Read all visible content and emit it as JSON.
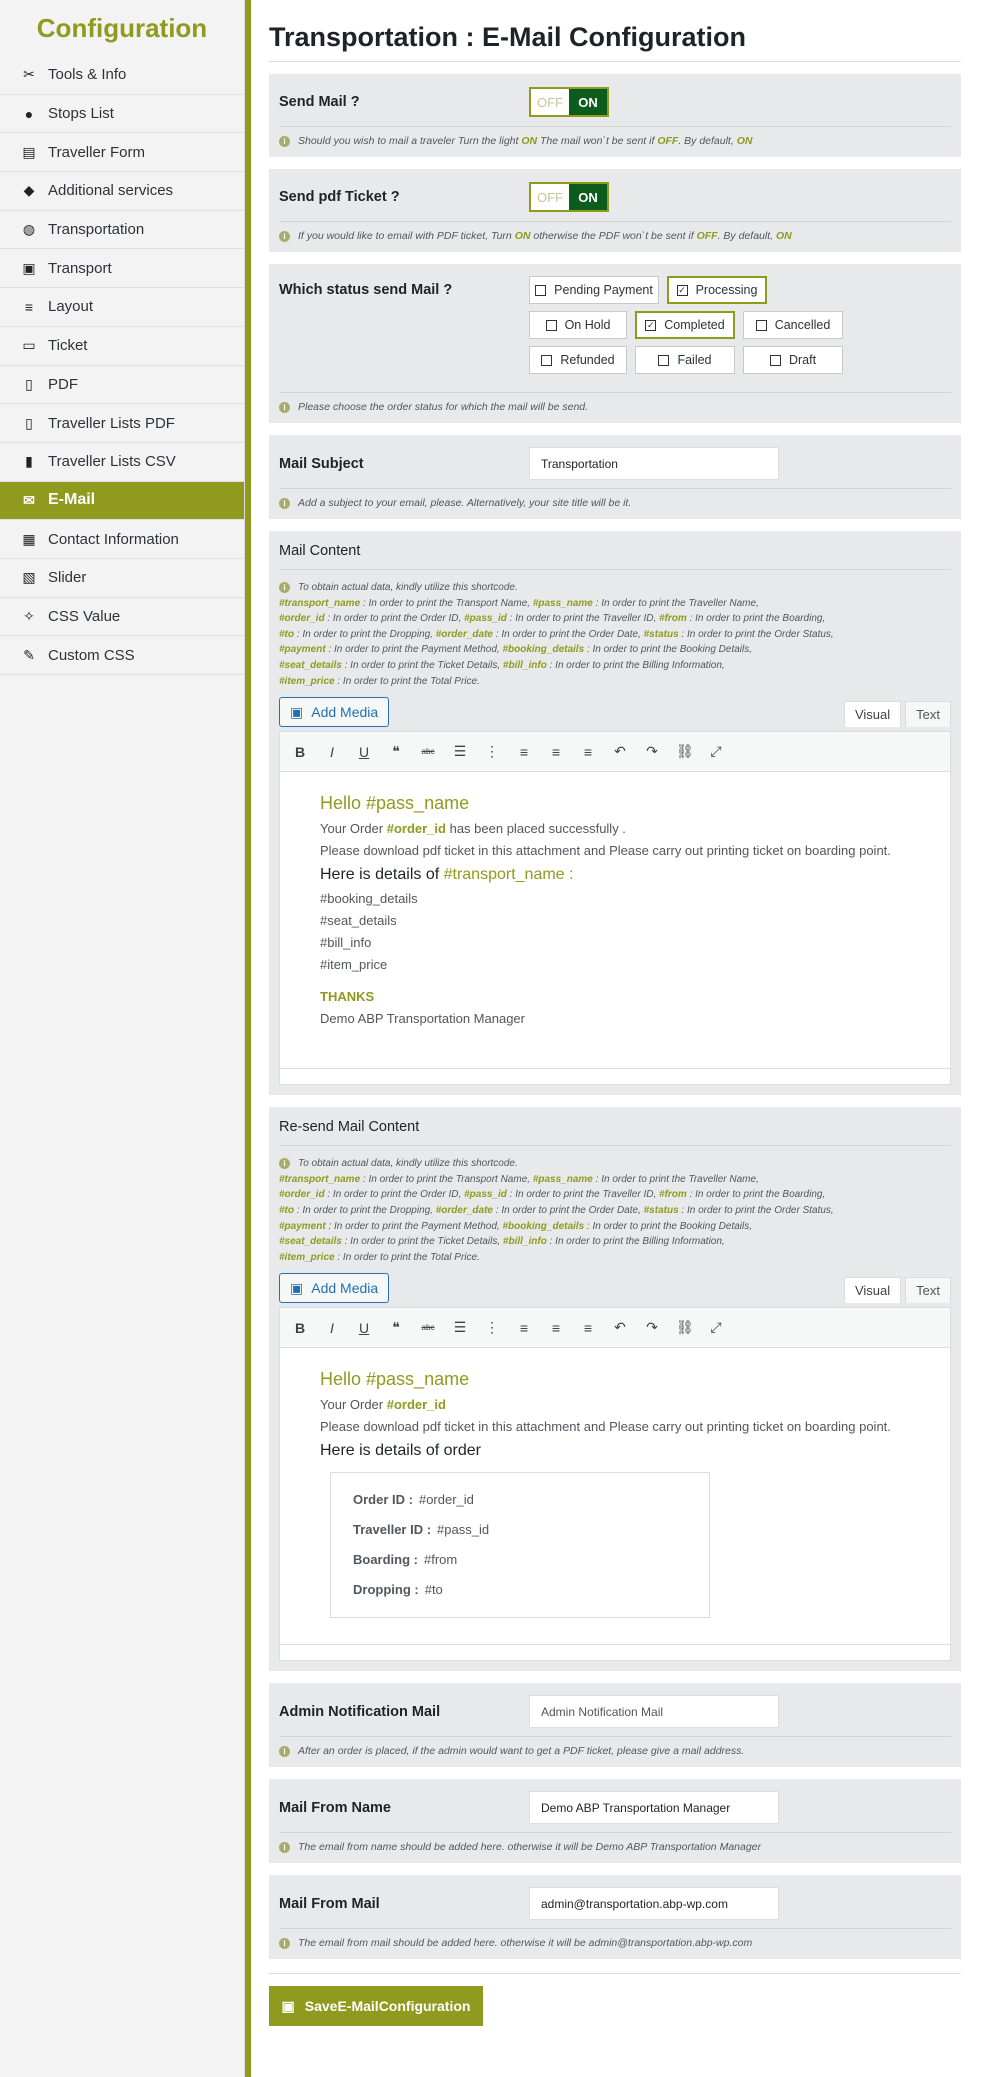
{
  "sidebar": {
    "title": "Configuration",
    "items": [
      {
        "label": "Tools & Info",
        "icon": "tools-icon",
        "glyph": "✂"
      },
      {
        "label": "Stops List",
        "icon": "pin-icon",
        "glyph": "●"
      },
      {
        "label": "Traveller Form",
        "icon": "form-icon",
        "glyph": "▤"
      },
      {
        "label": "Additional services",
        "icon": "service-icon",
        "glyph": "◆"
      },
      {
        "label": "Transportation",
        "icon": "globe-icon",
        "glyph": "◍"
      },
      {
        "label": "Transport",
        "icon": "bus-icon",
        "glyph": "▣"
      },
      {
        "label": "Layout",
        "icon": "layers-icon",
        "glyph": "≡"
      },
      {
        "label": "Ticket",
        "icon": "ticket-icon",
        "glyph": "▭"
      },
      {
        "label": "PDF",
        "icon": "file-pdf-icon",
        "glyph": "▯"
      },
      {
        "label": "Traveller Lists PDF",
        "icon": "file-icon",
        "glyph": "▯"
      },
      {
        "label": "Traveller Lists CSV",
        "icon": "file-csv-icon",
        "glyph": "▮"
      },
      {
        "label": "E-Mail",
        "icon": "envelope-icon",
        "glyph": "✉"
      },
      {
        "label": "Contact Information",
        "icon": "contact-icon",
        "glyph": "▦"
      },
      {
        "label": "Slider",
        "icon": "images-icon",
        "glyph": "▧"
      },
      {
        "label": "CSS Value",
        "icon": "magic-icon",
        "glyph": "✧"
      },
      {
        "label": "Custom CSS",
        "icon": "brush-icon",
        "glyph": "✎"
      }
    ]
  },
  "page": {
    "title": "Transportation : E-Mail Configuration"
  },
  "send_mail": {
    "label": "Send Mail ?",
    "off": "OFF",
    "on": "ON",
    "hint_a": "Should you wish to mail a traveler Turn the light ",
    "hint_on": "ON",
    "hint_b": " The mail won`t be sent if ",
    "hint_off": "OFF",
    "hint_c": ". By default, ",
    "hint_default": "ON"
  },
  "send_pdf": {
    "label": "Send pdf Ticket ?",
    "off": "OFF",
    "on": "ON",
    "hint_a": "If you would like to email with PDF ticket, Turn ",
    "hint_on": "ON",
    "hint_b": " otherwise the PDF won`t be sent if ",
    "hint_off": "OFF",
    "hint_c": ". By default, ",
    "hint_default": "ON"
  },
  "status": {
    "label": "Which status send Mail ?",
    "options": [
      {
        "label": "Pending Payment",
        "checked": false,
        "w": 130
      },
      {
        "label": "Processing",
        "checked": true,
        "w": 100
      },
      {
        "label": "On Hold",
        "checked": false,
        "w": 98
      },
      {
        "label": "Completed",
        "checked": true,
        "w": 100
      },
      {
        "label": "Cancelled",
        "checked": false,
        "w": 100
      },
      {
        "label": "Refunded",
        "checked": false,
        "w": 98
      },
      {
        "label": "Failed",
        "checked": false,
        "w": 100
      },
      {
        "label": "Draft",
        "checked": false,
        "w": 100
      }
    ],
    "hint": "Please choose the order status for which the mail will be send."
  },
  "subject": {
    "label": "Mail Subject",
    "value": "Transportation",
    "hint": "Add a subject to your email, please. Alternatively, your site title will be it."
  },
  "shortcodes": {
    "intro": "To obtain actual data, kindly utilize this shortcode.",
    "lines": [
      [
        [
          "#transport_name",
          " : In order to print the Transport Name, "
        ],
        [
          "#pass_name",
          " : In order to print the Traveller Name,"
        ]
      ],
      [
        [
          "#order_id",
          " : In order to print the Order ID, "
        ],
        [
          "#pass_id",
          " : In order to print the Traveller ID, "
        ],
        [
          "#from",
          " : In order to print the Boarding,"
        ]
      ],
      [
        [
          "#to",
          " : In order to print the Dropping, "
        ],
        [
          "#order_date",
          " : In order to print the Order Date, "
        ],
        [
          "#status",
          " : In order to print the Order Status,"
        ]
      ],
      [
        [
          "#payment",
          " : In order to print the Payment Method, "
        ],
        [
          "#booking_details",
          " : In order to print the Booking Details,"
        ]
      ],
      [
        [
          "#seat_details",
          " : In order to print the Ticket Details, "
        ],
        [
          "#bill_info",
          " : In order to print the Billing Information,"
        ]
      ],
      [
        [
          "#item_price",
          " : In order to print the Total Price."
        ]
      ]
    ]
  },
  "editor_common": {
    "add_media": "Add Media",
    "tab_visual": "Visual",
    "tab_text": "Text",
    "toolbar": [
      {
        "name": "bold-icon",
        "glyph": "B"
      },
      {
        "name": "italic-icon",
        "glyph": "I"
      },
      {
        "name": "underline-icon",
        "glyph": "U"
      },
      {
        "name": "blockquote-icon",
        "glyph": "❝"
      },
      {
        "name": "strikethrough-icon",
        "glyph": "abc"
      },
      {
        "name": "bullet-list-icon",
        "glyph": "☰"
      },
      {
        "name": "numbered-list-icon",
        "glyph": "⋮"
      },
      {
        "name": "align-left-icon",
        "glyph": "≡"
      },
      {
        "name": "align-center-icon",
        "glyph": "≡"
      },
      {
        "name": "align-right-icon",
        "glyph": "≡"
      },
      {
        "name": "undo-icon",
        "glyph": "↶"
      },
      {
        "name": "redo-icon",
        "glyph": "↷"
      },
      {
        "name": "link-icon",
        "glyph": "⛓"
      },
      {
        "name": "fullscreen-icon",
        "glyph": "⤢"
      }
    ]
  },
  "mail_content": {
    "label": "Mail Content",
    "greeting": "Hello #pass_name",
    "order_a": "Your Order ",
    "order_id": "#order_id",
    "order_b": " has been placed successfully .",
    "download": "Please download pdf ticket in this attachment and Please carry out printing ticket on boarding point.",
    "details_a": "Here is details of ",
    "details_b": "#transport_name :",
    "items": [
      "#booking_details",
      "#seat_details",
      "#bill_info",
      "#item_price"
    ],
    "thanks": "THANKS",
    "signature": "Demo ABP Transportation Manager"
  },
  "resend_content": {
    "label": "Re-send Mail Content",
    "greeting": "Hello #pass_name",
    "order_a": "Your Order ",
    "order_id": "#order_id",
    "download": "Please download pdf ticket in this attachment and Please carry out printing ticket on boarding point.",
    "details": "Here is details of order",
    "rows": [
      {
        "k": "Order ID :",
        "v": "#order_id"
      },
      {
        "k": "Traveller ID :",
        "v": "#pass_id"
      },
      {
        "k": "Boarding :",
        "v": "#from"
      },
      {
        "k": "Dropping :",
        "v": "#to"
      }
    ]
  },
  "admin_mail": {
    "label": "Admin Notification Mail",
    "placeholder": "Admin Notification Mail",
    "hint": "After an order is placed, if the admin would want to get a PDF ticket, please give a mail address."
  },
  "from_name": {
    "label": "Mail From Name",
    "value": "Demo ABP Transportation Manager",
    "hint": "The email from name should be added here. otherwise it will be Demo ABP Transportation Manager"
  },
  "from_mail": {
    "label": "Mail From Mail",
    "value": "admin@transportation.abp-wp.com",
    "hint": "The email from mail should be added here. otherwise it will be admin@transportation.abp-wp.com"
  },
  "save_button": {
    "label": "SaveE-MailConfiguration"
  },
  "colors": {
    "accent": "#8f9a1e",
    "toggle_on": "#0c5c1e",
    "section_bg": "#e8e9eb"
  }
}
